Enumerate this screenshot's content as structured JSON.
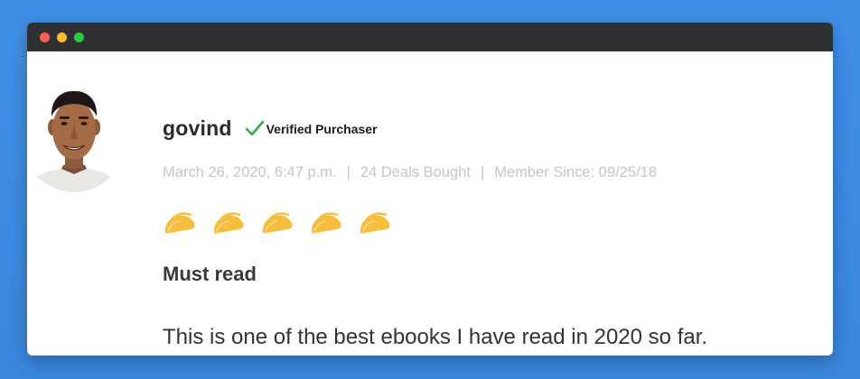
{
  "window": {
    "controls": [
      "close",
      "minimize",
      "maximize"
    ],
    "colors": {
      "close": "#fe5f57",
      "minimize": "#febc2e",
      "maximize": "#28c840",
      "titlebar": "#2f3033",
      "background": "#3f8fe6"
    }
  },
  "review": {
    "avatar_icon": "user-photo",
    "username": "govind",
    "verified_icon": "green-checkmark-icon",
    "verified_label": "Verified Purchaser",
    "meta": {
      "date": "March 26, 2020, 6:47 p.m.",
      "separator": "|",
      "deals": "24 Deals Bought",
      "member_since": "Member Since: 09/25/18"
    },
    "rating": {
      "value": 5,
      "max": 5,
      "icon": "taco-icon",
      "color": "#f7bd3c"
    },
    "title": "Must read",
    "body": "This is one of the best ebooks I have read in 2020 so far."
  }
}
